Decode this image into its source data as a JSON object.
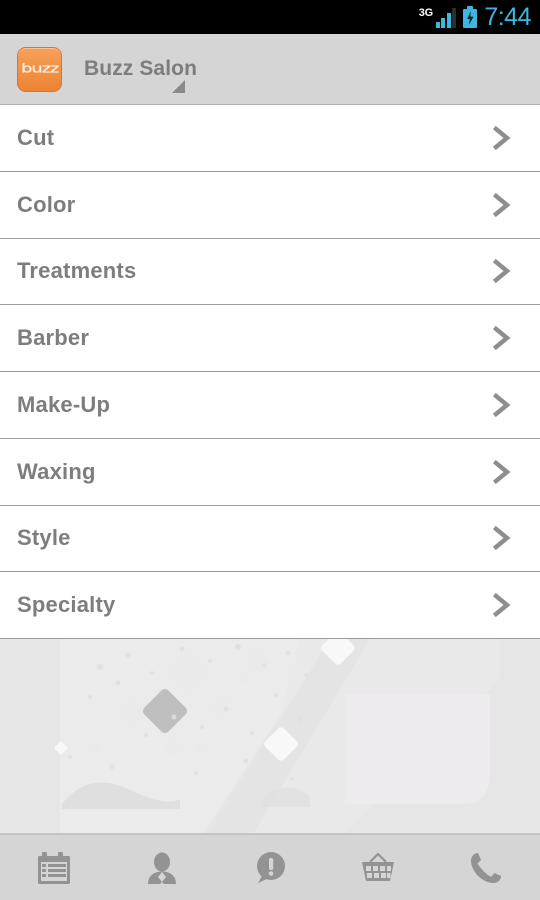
{
  "status_bar": {
    "network_label": "3G",
    "network_icon": "signal-bars-icon",
    "battery_icon": "battery-charging-icon",
    "time": "7:44",
    "accent_color": "#3bb7e0",
    "background_color": "#000000"
  },
  "action_bar": {
    "logo_icon": "buzz-app-logo-icon",
    "logo_text": "buzz",
    "logo_color": "#ed8433",
    "title": "Buzz Salon",
    "spinner_icon": "spinner-triangle-icon",
    "background_color": "#d5d5d5",
    "title_color": "#7d7d7d"
  },
  "list": {
    "accessory_icon": "chevron-right-icon",
    "row_color": "#ffffff",
    "divider_color": "#9c9c9c",
    "label_color": "#7d7d7d",
    "items": [
      {
        "label": "Cut"
      },
      {
        "label": "Color"
      },
      {
        "label": "Treatments"
      },
      {
        "label": "Barber"
      },
      {
        "label": "Make-Up"
      },
      {
        "label": "Waxing"
      },
      {
        "label": "Style"
      },
      {
        "label": "Specialty"
      }
    ]
  },
  "content": {
    "watermark_icon": "background-watermark-graphic",
    "background_color": "#e6e6e6"
  },
  "tab_bar": {
    "background_color": "#d5d5d5",
    "icon_color": "#939393",
    "tabs": [
      {
        "name": "appointments",
        "icon": "calendar-list-icon"
      },
      {
        "name": "profile",
        "icon": "person-icon"
      },
      {
        "name": "alerts",
        "icon": "speech-bubble-alert-icon"
      },
      {
        "name": "shop",
        "icon": "shopping-basket-icon"
      },
      {
        "name": "call",
        "icon": "phone-icon"
      }
    ]
  }
}
